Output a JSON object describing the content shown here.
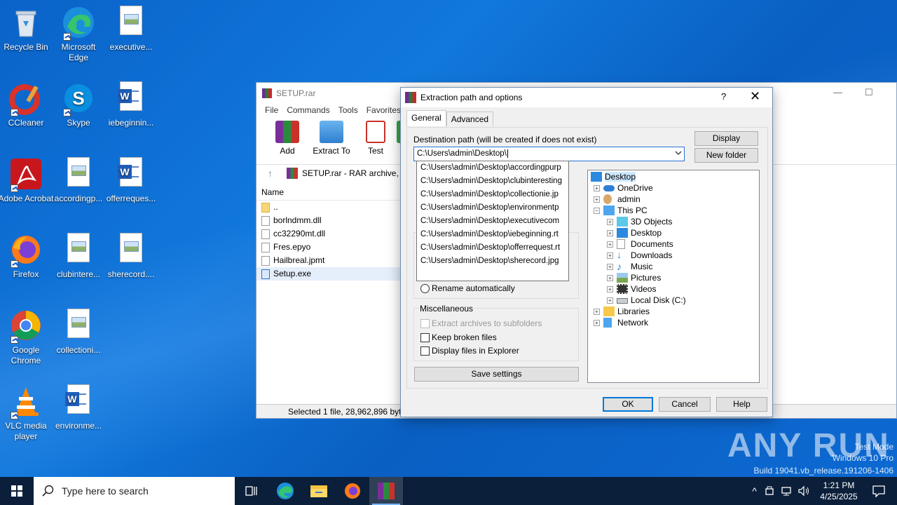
{
  "desktop": {
    "icons": [
      {
        "label": "Recycle Bin"
      },
      {
        "label": "Microsoft Edge"
      },
      {
        "label": "executive..."
      },
      {
        "label": "CCleaner"
      },
      {
        "label": "Skype"
      },
      {
        "label": "iebeginnin..."
      },
      {
        "label": "Adobe Acrobat"
      },
      {
        "label": "accordingp..."
      },
      {
        "label": "offerreques..."
      },
      {
        "label": "Firefox"
      },
      {
        "label": "clubintere..."
      },
      {
        "label": "sherecord...."
      },
      {
        "label": "Google Chrome"
      },
      {
        "label": "collectioni..."
      },
      {
        "label": "VLC media player"
      },
      {
        "label": "environme..."
      }
    ]
  },
  "rar": {
    "title": "SETUP.rar",
    "menu": [
      "File",
      "Commands",
      "Tools",
      "Favorites"
    ],
    "toolbar": [
      "Add",
      "Extract To",
      "Test",
      "Vi"
    ],
    "address": "SETUP.rar - RAR archive,",
    "column_name": "Name",
    "files": [
      "..",
      "borlndmm.dll",
      "cc32290mt.dll",
      "Fres.epyo",
      "Hailbreal.jpmt",
      "Setup.exe"
    ],
    "status": "Selected 1 file, 28,962,896 bytes"
  },
  "dialog": {
    "title": "Extraction path and options",
    "help_glyph": "?",
    "close_glyph": "✕",
    "tabs": [
      "General",
      "Advanced"
    ],
    "dest_label": "Destination path (will be created if does not exist)",
    "dest_value": "C:\\Users\\admin\\Desktop\\",
    "dropdown": [
      "C:\\Users\\admin\\Desktop\\accordingpurp",
      "C:\\Users\\admin\\Desktop\\clubinteresting",
      "C:\\Users\\admin\\Desktop\\collectionie.jp",
      "C:\\Users\\admin\\Desktop\\environmentp",
      "C:\\Users\\admin\\Desktop\\executivecom",
      "C:\\Users\\admin\\Desktop\\iebeginning.rt",
      "C:\\Users\\admin\\Desktop\\offerrequest.rt",
      "C:\\Users\\admin\\Desktop\\sherecord.jpg"
    ],
    "display_btn": "Display",
    "newfolder_btn": "New folder",
    "rename_auto": "Rename automatically",
    "misc_label": "Miscellaneous",
    "extract_sub": "Extract archives to subfolders",
    "keep_broken": "Keep broken files",
    "display_files": "Display files in Explorer",
    "save_settings": "Save settings",
    "tree": [
      "Desktop",
      "OneDrive",
      "admin",
      "This PC",
      "3D Objects",
      "Desktop",
      "Documents",
      "Downloads",
      "Music",
      "Pictures",
      "Videos",
      "Local Disk (C:)",
      "Libraries",
      "Network"
    ],
    "ok": "OK",
    "cancel": "Cancel",
    "help": "Help"
  },
  "watermark": {
    "brand": "ANY RUN",
    "mode": "Test Mode",
    "os": "Windows 10 Pro",
    "build": "Build 19041.vb_release.191206-1406"
  },
  "taskbar": {
    "search_placeholder": "Type here to search",
    "time": "1:21 PM",
    "date": "4/25/2025"
  }
}
